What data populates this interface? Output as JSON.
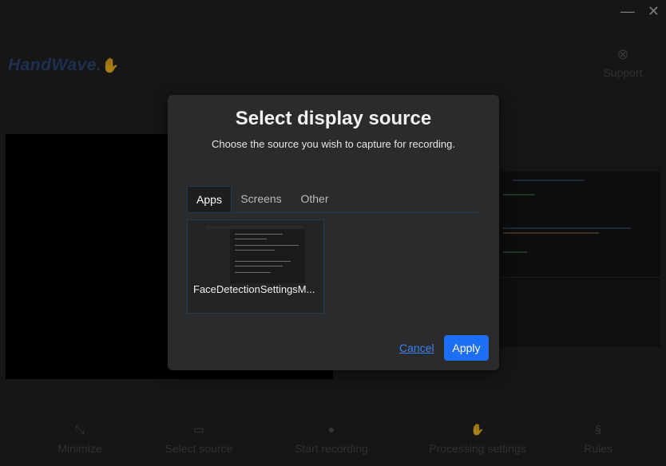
{
  "app": {
    "logo_text": "HandWave."
  },
  "window_controls": {
    "minimize": "—",
    "close": "✕"
  },
  "header": {
    "support_label": "Support",
    "support_icon": "lifebuoy-icon"
  },
  "bottom_bar": [
    {
      "label": "Minimize",
      "icon": "minimize-icon"
    },
    {
      "label": "Select source",
      "icon": "monitor-icon"
    },
    {
      "label": "Start recording",
      "icon": "record-icon"
    },
    {
      "label": "Processing settings",
      "icon": "hand-icon"
    },
    {
      "label": "Rules",
      "icon": "section-icon"
    }
  ],
  "modal": {
    "title": "Select display source",
    "subtitle": "Choose the source you wish to capture for recording.",
    "tabs": [
      "Apps",
      "Screens",
      "Other"
    ],
    "active_tab": "Apps",
    "sources": [
      {
        "name": "FaceDetectionSettingsM..."
      }
    ],
    "cancel_label": "Cancel",
    "apply_label": "Apply"
  },
  "colors": {
    "accent": "#1c6ef2",
    "link": "#3b82f6",
    "modal_bg": "#2b2b2b",
    "app_bg": "#222222",
    "logo": "#2d4a7a"
  }
}
